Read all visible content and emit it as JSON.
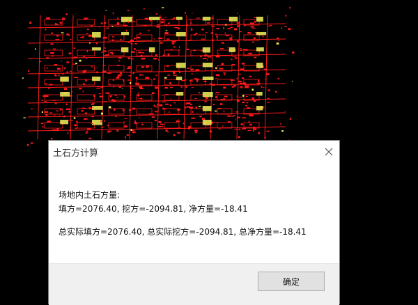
{
  "dialog": {
    "title": "土石方计算",
    "close_icon": "close-icon",
    "heading": "场地内土石方量:",
    "site_line": "填方=2076.40, 挖方=-2094.81, 净方量=-18.41",
    "total_line": "总实际填方=2076.40, 总实际挖方=-2094.81, 总净方量=-18.41",
    "ok_label": "确定"
  },
  "colors": {
    "background": "#000000",
    "cad_red": "#ff1a1a",
    "cad_yellow": "#f2f25a",
    "dialog_bg": "#ffffff",
    "footer_bg": "#f0f0f0"
  }
}
